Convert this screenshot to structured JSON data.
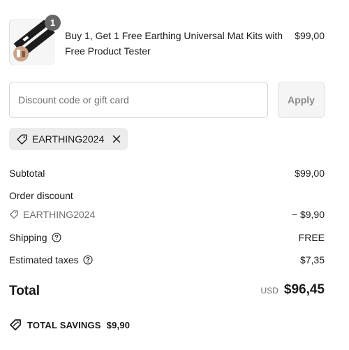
{
  "product": {
    "quantity": "1",
    "name": "Buy 1, Get 1 Free Earthing Universal Mat Kits with Free Product Tester",
    "price": "$99,00",
    "image_icon": "product-thumbnail"
  },
  "discount": {
    "placeholder": "Discount code or gift card",
    "value": "",
    "apply_label": "Apply",
    "applied_code": "EARTHING2024"
  },
  "summary": {
    "subtotal_label": "Subtotal",
    "subtotal_value": "$99,00",
    "order_discount_label": "Order discount",
    "discount_code": "EARTHING2024",
    "discount_value": "− $9,90",
    "shipping_label": "Shipping",
    "shipping_value": "FREE",
    "taxes_label": "Estimated taxes",
    "taxes_value": "$7,35",
    "total_label": "Total",
    "currency": "USD",
    "total_value": "$96,45",
    "savings_label": "TOTAL SAVINGS",
    "savings_value": "$9,90"
  },
  "icons": {
    "tag": "tag-icon",
    "close": "close-icon",
    "help": "question-circle-icon",
    "savings": "discount-tag-icon"
  },
  "colors": {
    "text": "#1a1a1a",
    "muted": "#707070",
    "chip_bg": "#ececec",
    "badge_bg": "#666666",
    "button_bg": "#f5f5f5"
  }
}
